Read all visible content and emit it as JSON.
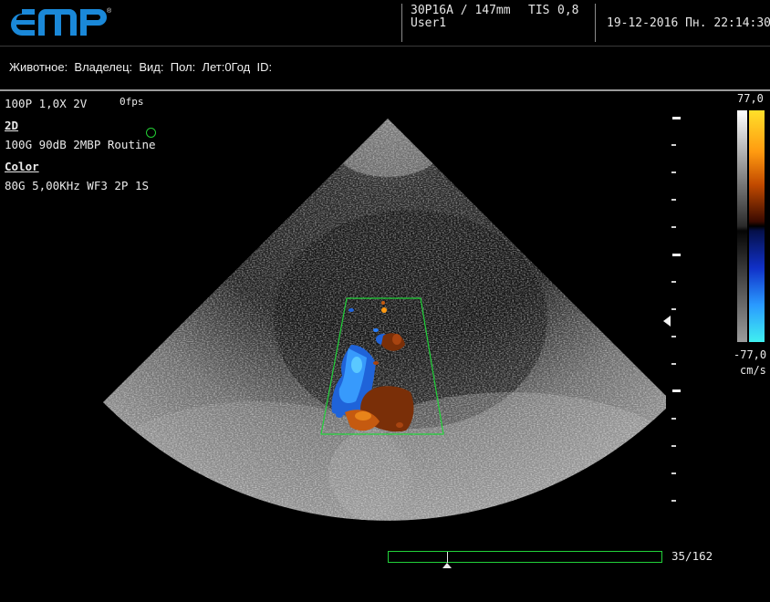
{
  "header": {
    "logo": "EMP",
    "probe": "30P16A / 147mm",
    "tis_label": "TIS",
    "tis_value": "0,8",
    "user": "User1",
    "datetime": "19-12-2016 Пн. 22:14:30"
  },
  "patient": {
    "line": "Животное:  Владелец:  Вид:  Пол:  Лет:0Год  ID:"
  },
  "params": {
    "line1": "100P 1,0X  2V",
    "fps": "0fps",
    "mode_2d": "2D",
    "line_2d": "100G 90dB 2MBP Routine",
    "mode_color": "Color",
    "line_color": "80G 5,00KHz WF3 2P 1S"
  },
  "colorbar": {
    "max": "77,0",
    "min": "-77,0",
    "unit": "cm/s"
  },
  "cine": {
    "frame": 35,
    "total": 162,
    "label": "35/162"
  },
  "colors": {
    "roi_box": "#22d23a",
    "focus_marker": "#22cc33",
    "logo": "#1a88d8"
  },
  "icons": {
    "focus": "circle-marker-icon",
    "focus_depth": "left-triangle-icon",
    "cine_position": "up-triangle-icon"
  }
}
